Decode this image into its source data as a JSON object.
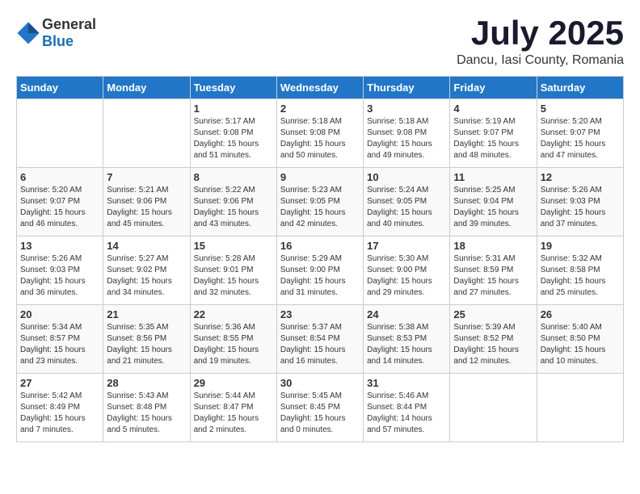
{
  "logo": {
    "general": "General",
    "blue": "Blue"
  },
  "title": {
    "month": "July 2025",
    "location": "Dancu, Iasi County, Romania"
  },
  "headers": [
    "Sunday",
    "Monday",
    "Tuesday",
    "Wednesday",
    "Thursday",
    "Friday",
    "Saturday"
  ],
  "weeks": [
    [
      {
        "day": "",
        "info": ""
      },
      {
        "day": "",
        "info": ""
      },
      {
        "day": "1",
        "info": "Sunrise: 5:17 AM\nSunset: 9:08 PM\nDaylight: 15 hours\nand 51 minutes."
      },
      {
        "day": "2",
        "info": "Sunrise: 5:18 AM\nSunset: 9:08 PM\nDaylight: 15 hours\nand 50 minutes."
      },
      {
        "day": "3",
        "info": "Sunrise: 5:18 AM\nSunset: 9:08 PM\nDaylight: 15 hours\nand 49 minutes."
      },
      {
        "day": "4",
        "info": "Sunrise: 5:19 AM\nSunset: 9:07 PM\nDaylight: 15 hours\nand 48 minutes."
      },
      {
        "day": "5",
        "info": "Sunrise: 5:20 AM\nSunset: 9:07 PM\nDaylight: 15 hours\nand 47 minutes."
      }
    ],
    [
      {
        "day": "6",
        "info": "Sunrise: 5:20 AM\nSunset: 9:07 PM\nDaylight: 15 hours\nand 46 minutes."
      },
      {
        "day": "7",
        "info": "Sunrise: 5:21 AM\nSunset: 9:06 PM\nDaylight: 15 hours\nand 45 minutes."
      },
      {
        "day": "8",
        "info": "Sunrise: 5:22 AM\nSunset: 9:06 PM\nDaylight: 15 hours\nand 43 minutes."
      },
      {
        "day": "9",
        "info": "Sunrise: 5:23 AM\nSunset: 9:05 PM\nDaylight: 15 hours\nand 42 minutes."
      },
      {
        "day": "10",
        "info": "Sunrise: 5:24 AM\nSunset: 9:05 PM\nDaylight: 15 hours\nand 40 minutes."
      },
      {
        "day": "11",
        "info": "Sunrise: 5:25 AM\nSunset: 9:04 PM\nDaylight: 15 hours\nand 39 minutes."
      },
      {
        "day": "12",
        "info": "Sunrise: 5:26 AM\nSunset: 9:03 PM\nDaylight: 15 hours\nand 37 minutes."
      }
    ],
    [
      {
        "day": "13",
        "info": "Sunrise: 5:26 AM\nSunset: 9:03 PM\nDaylight: 15 hours\nand 36 minutes."
      },
      {
        "day": "14",
        "info": "Sunrise: 5:27 AM\nSunset: 9:02 PM\nDaylight: 15 hours\nand 34 minutes."
      },
      {
        "day": "15",
        "info": "Sunrise: 5:28 AM\nSunset: 9:01 PM\nDaylight: 15 hours\nand 32 minutes."
      },
      {
        "day": "16",
        "info": "Sunrise: 5:29 AM\nSunset: 9:00 PM\nDaylight: 15 hours\nand 31 minutes."
      },
      {
        "day": "17",
        "info": "Sunrise: 5:30 AM\nSunset: 9:00 PM\nDaylight: 15 hours\nand 29 minutes."
      },
      {
        "day": "18",
        "info": "Sunrise: 5:31 AM\nSunset: 8:59 PM\nDaylight: 15 hours\nand 27 minutes."
      },
      {
        "day": "19",
        "info": "Sunrise: 5:32 AM\nSunset: 8:58 PM\nDaylight: 15 hours\nand 25 minutes."
      }
    ],
    [
      {
        "day": "20",
        "info": "Sunrise: 5:34 AM\nSunset: 8:57 PM\nDaylight: 15 hours\nand 23 minutes."
      },
      {
        "day": "21",
        "info": "Sunrise: 5:35 AM\nSunset: 8:56 PM\nDaylight: 15 hours\nand 21 minutes."
      },
      {
        "day": "22",
        "info": "Sunrise: 5:36 AM\nSunset: 8:55 PM\nDaylight: 15 hours\nand 19 minutes."
      },
      {
        "day": "23",
        "info": "Sunrise: 5:37 AM\nSunset: 8:54 PM\nDaylight: 15 hours\nand 16 minutes."
      },
      {
        "day": "24",
        "info": "Sunrise: 5:38 AM\nSunset: 8:53 PM\nDaylight: 15 hours\nand 14 minutes."
      },
      {
        "day": "25",
        "info": "Sunrise: 5:39 AM\nSunset: 8:52 PM\nDaylight: 15 hours\nand 12 minutes."
      },
      {
        "day": "26",
        "info": "Sunrise: 5:40 AM\nSunset: 8:50 PM\nDaylight: 15 hours\nand 10 minutes."
      }
    ],
    [
      {
        "day": "27",
        "info": "Sunrise: 5:42 AM\nSunset: 8:49 PM\nDaylight: 15 hours\nand 7 minutes."
      },
      {
        "day": "28",
        "info": "Sunrise: 5:43 AM\nSunset: 8:48 PM\nDaylight: 15 hours\nand 5 minutes."
      },
      {
        "day": "29",
        "info": "Sunrise: 5:44 AM\nSunset: 8:47 PM\nDaylight: 15 hours\nand 2 minutes."
      },
      {
        "day": "30",
        "info": "Sunrise: 5:45 AM\nSunset: 8:45 PM\nDaylight: 15 hours\nand 0 minutes."
      },
      {
        "day": "31",
        "info": "Sunrise: 5:46 AM\nSunset: 8:44 PM\nDaylight: 14 hours\nand 57 minutes."
      },
      {
        "day": "",
        "info": ""
      },
      {
        "day": "",
        "info": ""
      }
    ]
  ]
}
